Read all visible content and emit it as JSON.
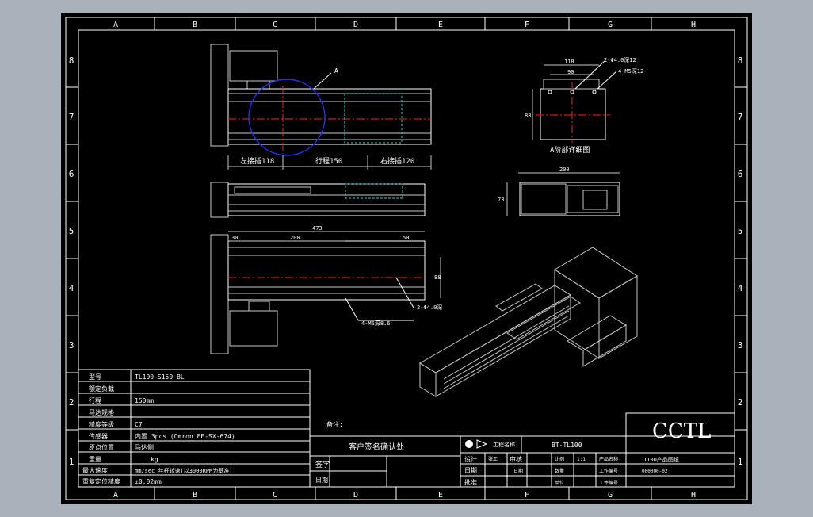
{
  "frame": {
    "columns": [
      "A",
      "B",
      "C",
      "D",
      "E",
      "F",
      "G",
      "H"
    ],
    "rows": [
      "8",
      "7",
      "6",
      "5",
      "4",
      "3",
      "2",
      "1"
    ]
  },
  "callouts": {
    "a_mark": "A",
    "left_connect": "左接插118",
    "stroke": "行程150",
    "right_connect": "右接插120",
    "detail_title": "A阶部详细图",
    "hole1": "2-Φ4.0深12",
    "hole2": "4-M5深12",
    "dim_118": "118",
    "dim_90": "90",
    "dim_88": "88",
    "dim_200": "200",
    "dim_73": "73",
    "dim_473": "473",
    "dim_top30": "30",
    "dim_top200": "200",
    "dim_top50": "50",
    "dim_side": "88",
    "hole3": "2-Φ4.0深",
    "hole4": "4-M5深8.6"
  },
  "spec_table": {
    "rows": [
      {
        "label": "型号",
        "value": "TL100-S150-BL"
      },
      {
        "label": "额定负载",
        "value": ""
      },
      {
        "label": "行程",
        "value": "150mm"
      },
      {
        "label": "马达规格",
        "value": ""
      },
      {
        "label": "精度等级",
        "value": "C7"
      },
      {
        "label": "传感器",
        "value": "内置 3pcs (Omron EE-SX-674)"
      },
      {
        "label": "原点位置",
        "value": "马达侧"
      },
      {
        "label": "重量",
        "value": "kg"
      },
      {
        "label": "最大速度",
        "value": "mm/sec 丝杆转速(以3000RPM为基准)"
      },
      {
        "label": "重复定位精度",
        "value": "±0.02mm"
      }
    ]
  },
  "notes": {
    "label": "备注:"
  },
  "confirm": {
    "title": "客户签名确认处",
    "sign": "签字",
    "date": "日期"
  },
  "title_block": {
    "logo_text": "CCTL",
    "project_label": "工程名称",
    "project_value": "BT-TL100",
    "design": "设计",
    "design_val": "张工",
    "check": "审核",
    "draw": "日期",
    "draw_val": "日期",
    "approve": "批准",
    "approve_val": "",
    "scale_label": "比例",
    "scale_val": "1:1",
    "count_label": "数量",
    "count_val": "",
    "unit_label": "单位",
    "unit_val": "",
    "product_label": "产品名称",
    "product_val": "1100产品图纸",
    "workorder_label": "工作编号",
    "workorder_val": "000000-02",
    "num_label": "工件编号",
    "num_val": ""
  }
}
